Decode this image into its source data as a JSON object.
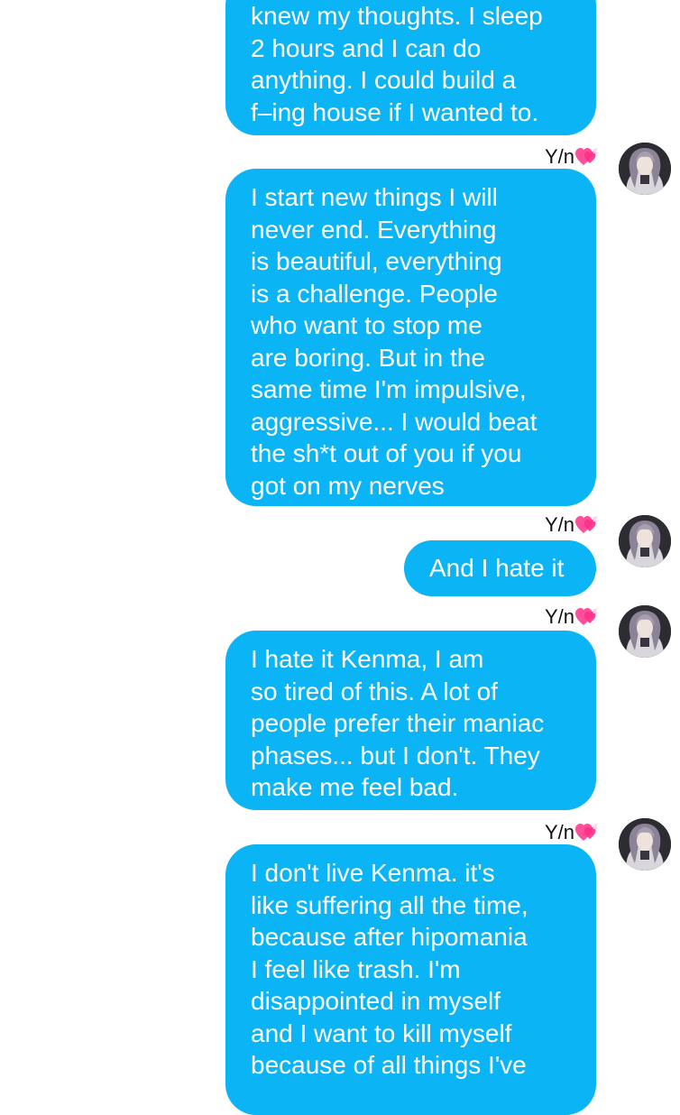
{
  "chat": {
    "sender_name": "Y/n",
    "sender_emoji": "heart-with-ribbon-icon",
    "bubble_color": "#0ab4f5",
    "messages": [
      {
        "text": "knew my thoughts. I sleep\n2 hours and I can do\nanything. I could build a\nf–ing house if I wanted to."
      },
      {
        "sender": "Y/n",
        "text": "I start new things I will\nnever end. Everything\nis beautiful, everything\nis a challenge. People\nwho want to stop me\nare boring. But in the\nsame time I'm impulsive,\naggressive... I would beat\nthe sh*t out of you if you\ngot on my nerves"
      },
      {
        "sender": "Y/n",
        "text": "And I hate it"
      },
      {
        "sender": "Y/n",
        "text": "I hate it Kenma, I am\nso tired of this. A lot of\npeople prefer their maniac\nphases... but I don't. They\nmake me feel bad."
      },
      {
        "sender": "Y/n",
        "text": "I don't live Kenma. it's\nlike suffering all the time,\nbecause after hipomania\nI feel like trash. I'm\ndisappointed in myself\nand I want to kill myself\nbecause of all things I've"
      }
    ]
  }
}
